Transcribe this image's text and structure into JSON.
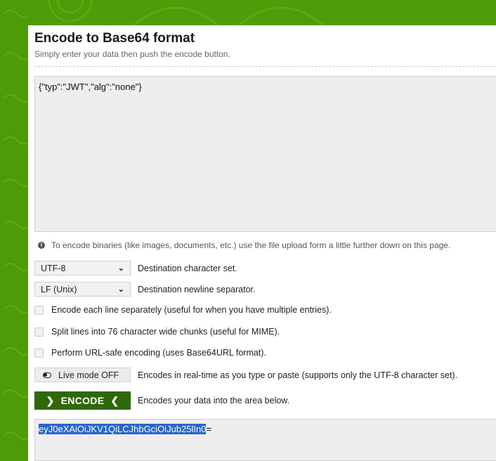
{
  "header": {
    "title": "Encode to Base64 format",
    "subtitle": "Simply enter your data then push the encode button."
  },
  "input": {
    "value": "{\"typ\":\"JWT\",\"alg\":\"none\"}"
  },
  "info": {
    "text": "To encode binaries (like images, documents, etc.) use the file upload form a little further down on this page."
  },
  "options": {
    "charset": {
      "value": "UTF-8",
      "label": "Destination character set."
    },
    "newline": {
      "value": "LF (Unix)",
      "label": "Destination newline separator."
    },
    "each_line": "Encode each line separately (useful for when you have multiple entries).",
    "split_lines": "Split lines into 76 character wide chunks (useful for MIME).",
    "url_safe": "Perform URL-safe encoding (uses Base64URL format).",
    "live_mode": {
      "button": "Live mode OFF",
      "label": "Encodes in real-time as you type or paste (supports only the UTF-8 character set)."
    }
  },
  "encode": {
    "button": "ENCODE",
    "label": "Encodes your data into the area below."
  },
  "output": {
    "selected": "eyJ0eXAiOiJKV1QiLCJhbGciOiJub25lIn0",
    "rest": "="
  }
}
